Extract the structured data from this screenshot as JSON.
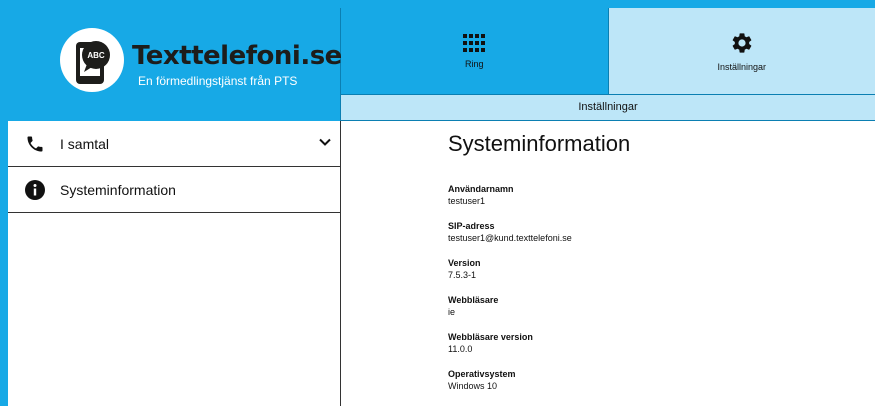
{
  "brand": {
    "badge_text": "ABC",
    "title": "Texttelefoni.se",
    "subtitle": "En förmedlingstjänst från PTS"
  },
  "nav": {
    "tabs": [
      {
        "label": "Ring",
        "icon": "keypad-icon"
      },
      {
        "label": "Inställningar",
        "icon": "gear-icon"
      }
    ],
    "active_tab": "Inställningar"
  },
  "subbar": {
    "label": "Inställningar"
  },
  "sidebar": {
    "items": [
      {
        "label": "I samtal",
        "icon": "phone-icon"
      },
      {
        "label": "Systeminformation",
        "icon": "info-icon"
      }
    ]
  },
  "main": {
    "title": "Systeminformation",
    "fields": [
      {
        "label": "Användarnamn",
        "value": "testuser1"
      },
      {
        "label": "SIP-adress",
        "value": "testuser1@kund.texttelefoni.se"
      },
      {
        "label": "Version",
        "value": "7.5.3-1"
      },
      {
        "label": "Webbläsare",
        "value": "ie"
      },
      {
        "label": "Webbläsare version",
        "value": "11.0.0"
      },
      {
        "label": "Operativsystem",
        "value": "Windows 10"
      }
    ]
  },
  "colors": {
    "brand_blue": "#17a9e6",
    "light_blue": "#bde6f8"
  }
}
